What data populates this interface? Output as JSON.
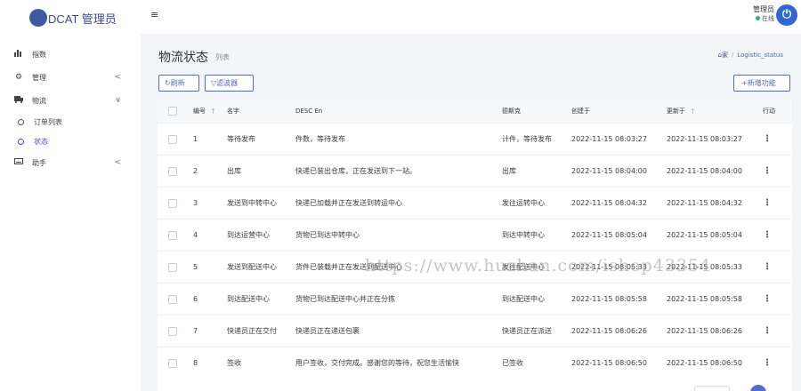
{
  "brand": {
    "name": "DCAT 管理员"
  },
  "sidebar": {
    "items": [
      {
        "label": "指数",
        "icon": "bar-chart-icon"
      },
      {
        "label": "管理",
        "icon": "gear-icon",
        "caret": "<"
      },
      {
        "label": "物流",
        "icon": "truck-icon",
        "caret": "∨"
      },
      {
        "label": "订单列表",
        "sub": true
      },
      {
        "label": "状态",
        "sub": true,
        "active": true
      },
      {
        "label": "助手",
        "icon": "keyboard-icon",
        "caret": "<"
      }
    ]
  },
  "topbar": {
    "menu_icon": "≡",
    "user_name": "管理员",
    "user_status": "在线"
  },
  "page": {
    "title": "物流状态",
    "subtitle": "列表",
    "breadcrumb_home": "家",
    "breadcrumb_current": "Logistic_status"
  },
  "toolbar": {
    "refresh_label": "刷新",
    "filter_label": "滤波器",
    "new_label": "+新增功能"
  },
  "table": {
    "headers": {
      "id": "编号",
      "name": "名字",
      "desc": "DESC En",
      "dname": "德斯克",
      "created": "创建于",
      "updated": "更新于",
      "action": "行动"
    },
    "rows": [
      {
        "id": "1",
        "name": "等待发布",
        "desc": "件数，等待发布",
        "dname": "计件，等待发布",
        "created": "2022-11-15 08:03:27",
        "updated": "2022-11-15 08:03:27"
      },
      {
        "id": "2",
        "name": "出库",
        "desc": "快递已装出仓库，正在发送到下一站。",
        "dname": "出库",
        "created": "2022-11-15 08:04:00",
        "updated": "2022-11-15 08:04:00"
      },
      {
        "id": "3",
        "name": "发送到中转中心",
        "desc": "快递已加载并正在发送到转运中心",
        "dname": "发往运转中心",
        "created": "2022-11-15 08:04:32",
        "updated": "2022-11-15 08:04:32"
      },
      {
        "id": "4",
        "name": "到达运营中心",
        "desc": "货物已到达中转中心",
        "dname": "到达中转中心",
        "created": "2022-11-15 08:05:04",
        "updated": "2022-11-15 08:05:04"
      },
      {
        "id": "5",
        "name": "发送到配送中心",
        "desc": "货件已装载并正在发送到配送中心",
        "dname": "发往配送中心",
        "created": "2022-11-15 08:05:33",
        "updated": "2022-11-15 08:05:33"
      },
      {
        "id": "6",
        "name": "到达配送中心",
        "desc": "货物已到达配送中心并正在分拣",
        "dname": "到达配送中心",
        "created": "2022-11-15 08:05:58",
        "updated": "2022-11-15 08:05:58"
      },
      {
        "id": "7",
        "name": "快递员正在交付",
        "desc": "快递员正在递送包裹",
        "dname": "快递员正在派送",
        "created": "2022-11-15 08:06:26",
        "updated": "2022-11-15 08:06:26"
      },
      {
        "id": "8",
        "name": "签收",
        "desc": "用户签收，交付完成。感谢您的等待，祝您生活愉快",
        "dname": "已签收",
        "created": "2022-11-15 08:06:50",
        "updated": "2022-11-15 08:06:50"
      }
    ]
  },
  "watermark": "https://www.huzhan.com/ishop43354",
  "colors": {
    "accent": "#586cb1",
    "online": "#21b978",
    "power": "#3067d6"
  }
}
